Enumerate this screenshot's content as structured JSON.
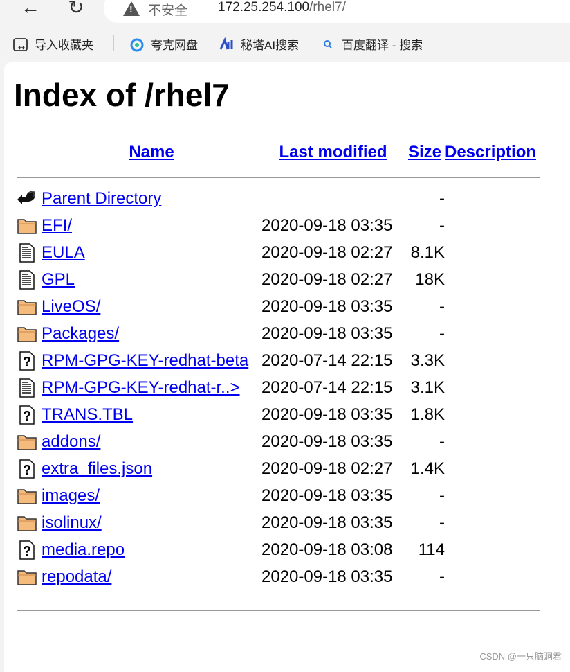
{
  "browser": {
    "security_label": "不安全",
    "url_host": "172.25.254.100",
    "url_path": "/rhel7/",
    "bookmarks": [
      {
        "label": "导入收藏夹",
        "icon": "import-folder-icon"
      },
      {
        "label": "夸克网盘",
        "icon": "cloud-icon"
      },
      {
        "label": "秘塔AI搜索",
        "icon": "metaso-icon"
      },
      {
        "label": "百度翻译 - 搜索",
        "icon": "search-icon"
      }
    ]
  },
  "page": {
    "title": "Index of /rhel7",
    "headers": {
      "name": "Name",
      "modified": "Last modified",
      "size": "Size",
      "description": "Description"
    },
    "rows": [
      {
        "icon": "back",
        "name": "Parent Directory",
        "modified": "",
        "size": "-"
      },
      {
        "icon": "folder",
        "name": "EFI/",
        "modified": "2020-09-18 03:35",
        "size": "-"
      },
      {
        "icon": "text",
        "name": "EULA",
        "modified": "2020-09-18 02:27",
        "size": "8.1K"
      },
      {
        "icon": "text",
        "name": "GPL",
        "modified": "2020-09-18 02:27",
        "size": "18K"
      },
      {
        "icon": "folder",
        "name": "LiveOS/",
        "modified": "2020-09-18 03:35",
        "size": "-"
      },
      {
        "icon": "folder",
        "name": "Packages/",
        "modified": "2020-09-18 03:35",
        "size": "-"
      },
      {
        "icon": "unknown",
        "name": "RPM-GPG-KEY-redhat-beta",
        "modified": "2020-07-14 22:15",
        "size": "3.3K"
      },
      {
        "icon": "text",
        "name": "RPM-GPG-KEY-redhat-r..>",
        "modified": "2020-07-14 22:15",
        "size": "3.1K"
      },
      {
        "icon": "unknown",
        "name": "TRANS.TBL",
        "modified": "2020-09-18 03:35",
        "size": "1.8K"
      },
      {
        "icon": "folder",
        "name": "addons/",
        "modified": "2020-09-18 03:35",
        "size": "-"
      },
      {
        "icon": "unknown",
        "name": "extra_files.json",
        "modified": "2020-09-18 02:27",
        "size": "1.4K"
      },
      {
        "icon": "folder",
        "name": "images/",
        "modified": "2020-09-18 03:35",
        "size": "-"
      },
      {
        "icon": "folder",
        "name": "isolinux/",
        "modified": "2020-09-18 03:35",
        "size": "-"
      },
      {
        "icon": "unknown",
        "name": "media.repo",
        "modified": "2020-09-18 03:08",
        "size": "114"
      },
      {
        "icon": "folder",
        "name": "repodata/",
        "modified": "2020-09-18 03:35",
        "size": "-"
      }
    ]
  },
  "watermark": "CSDN @一只脑洞君"
}
